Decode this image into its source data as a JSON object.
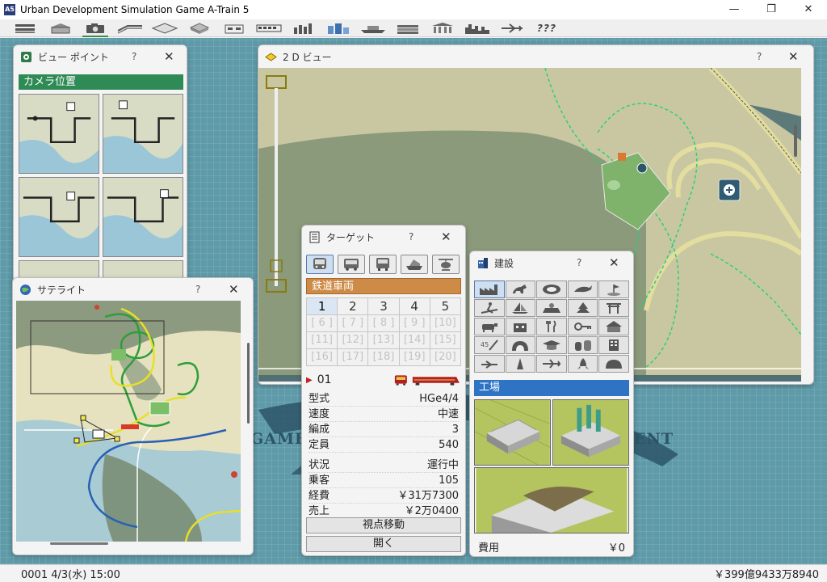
{
  "app": {
    "title": "Urban Development Simulation Game A-Train 5",
    "icon_text": "A5",
    "window_controls": {
      "minimize": "—",
      "maximize": "❐",
      "close": "✕"
    }
  },
  "toolbar": {
    "items": [
      {
        "icon": "menu-list-icon"
      },
      {
        "icon": "station-icon"
      },
      {
        "icon": "camera-icon"
      },
      {
        "icon": "track-icon"
      },
      {
        "icon": "terrain-icon"
      },
      {
        "icon": "building-icon"
      },
      {
        "icon": "facility-icon"
      },
      {
        "icon": "train-icon"
      },
      {
        "icon": "stock-chart-icon"
      },
      {
        "icon": "city-icon"
      },
      {
        "icon": "ship-icon"
      },
      {
        "icon": "money-icon"
      },
      {
        "icon": "bank-icon"
      },
      {
        "icon": "skyline-icon"
      },
      {
        "icon": "airplane-icon"
      },
      {
        "icon": "help-icon",
        "label": "???"
      }
    ]
  },
  "desktop": {
    "bg_text_left": "GAME.",
    "bg_text_right": "ENT"
  },
  "viewpoint": {
    "title": "ビュー ポイント",
    "help": "?",
    "close": "✕",
    "section_label": "カメラ位置"
  },
  "satellite": {
    "title": "サテライト",
    "help": "?",
    "close": "✕"
  },
  "view2d": {
    "title": "2 D ビュー",
    "help": "?",
    "close": "✕"
  },
  "target": {
    "title": "ターゲット",
    "help": "?",
    "close": "✕",
    "types": [
      {
        "icon": "train-front-icon"
      },
      {
        "icon": "bus-icon"
      },
      {
        "icon": "truck-icon"
      },
      {
        "icon": "ship-icon"
      },
      {
        "icon": "helicopter-icon"
      }
    ],
    "category": "鉄道車両",
    "numbers": [
      "1",
      "2",
      "3",
      "4",
      "5",
      "[ 6 ]",
      "[ 7 ]",
      "[ 8 ]",
      "[ 9 ]",
      "[10]",
      "[11]",
      "[12]",
      "[13]",
      "[14]",
      "[15]",
      "[16]",
      "[17]",
      "[18]",
      "[19]",
      "[20]"
    ],
    "unit_number": "01",
    "info": [
      {
        "label": "型式",
        "value": "HGe4/4"
      },
      {
        "label": "速度",
        "value": "中速"
      },
      {
        "label": "編成",
        "value": "3"
      },
      {
        "label": "定員",
        "value": "540"
      },
      {
        "label": "状況",
        "value": "運行中"
      },
      {
        "label": "乗客",
        "value": "105"
      },
      {
        "label": "経費",
        "value": "￥31万7300"
      },
      {
        "label": "売上",
        "value": "￥2万0400"
      }
    ],
    "btn_move": "視点移動",
    "btn_open": "開く"
  },
  "construction": {
    "title": "建設",
    "help": "?",
    "close": "✕",
    "category": "工場",
    "cost_label": "費用",
    "cost_value": "￥0"
  },
  "status": {
    "datetime": "0001  4/3(水) 15:00",
    "money": "￥399億9433万8940"
  }
}
